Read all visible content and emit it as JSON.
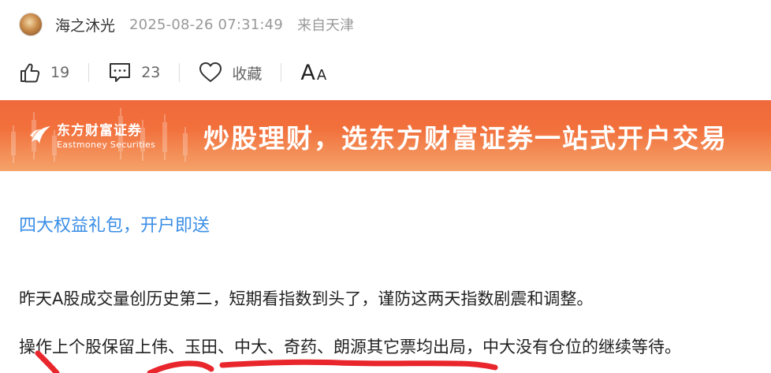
{
  "post": {
    "author": "海之沐光",
    "time": "2025-08-26 07:31:49",
    "location": "来自天津"
  },
  "actions": {
    "likes": "19",
    "comments": "23",
    "favorite_label": "收藏",
    "font_big": "A",
    "font_small": "A"
  },
  "banner": {
    "brand_cn": "东方财富证券",
    "brand_en": "Eastmoney Securities",
    "slogan": "炒股理财，选东方财富证券一站式开户交易"
  },
  "content": {
    "promo_link": "四大权益礼包，开户即送",
    "paragraphs": [
      "昨天A股成交量创历史第二，短期看指数到头了，谨防这两天指数剧震和调整。",
      "操作上个股保留上伟、玉田、中大、奇药、朗源其它票均出局，中大没有仓位的继续等待。"
    ]
  },
  "colors": {
    "banner_orange": "#f06a3c",
    "link_blue": "#3a8ee6",
    "annotation_red": "#e8262c"
  }
}
